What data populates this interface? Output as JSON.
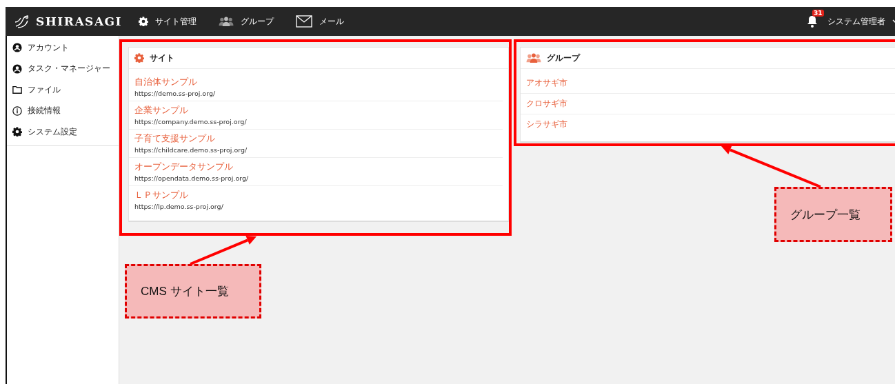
{
  "header": {
    "logo": "SHIRASAGI",
    "nav": [
      {
        "kind": "gear",
        "label": "サイト管理"
      },
      {
        "kind": "people",
        "label": "グループ"
      },
      {
        "kind": "mail",
        "label": "メール"
      }
    ],
    "notification_count": "31",
    "user": "システム管理者"
  },
  "sidebar": {
    "items": [
      {
        "kind": "user",
        "label": "アカウント"
      },
      {
        "kind": "user",
        "label": "タスク・マネージャー"
      },
      {
        "kind": "folder",
        "label": "ファイル"
      },
      {
        "kind": "info",
        "label": "接続情報"
      },
      {
        "kind": "gear",
        "label": "システム設定"
      }
    ]
  },
  "site_panel": {
    "title": "サイト",
    "sites": [
      {
        "name": "自治体サンプル",
        "url": "https://demo.ss-proj.org/"
      },
      {
        "name": "企業サンプル",
        "url": "https://company.demo.ss-proj.org/"
      },
      {
        "name": "子育て支援サンプル",
        "url": "https://childcare.demo.ss-proj.org/"
      },
      {
        "name": "オープンデータサンプル",
        "url": "https://opendata.demo.ss-proj.org/"
      },
      {
        "name": "ＬＰサンプル",
        "url": "https://lp.demo.ss-proj.org/"
      }
    ]
  },
  "group_panel": {
    "title": "グループ",
    "groups": [
      "アオサギ市",
      "クロサギ市",
      "シラサギ市"
    ]
  },
  "annotations": [
    {
      "label": "CMS サイト一覧"
    },
    {
      "label": "グループ一覧"
    }
  ]
}
